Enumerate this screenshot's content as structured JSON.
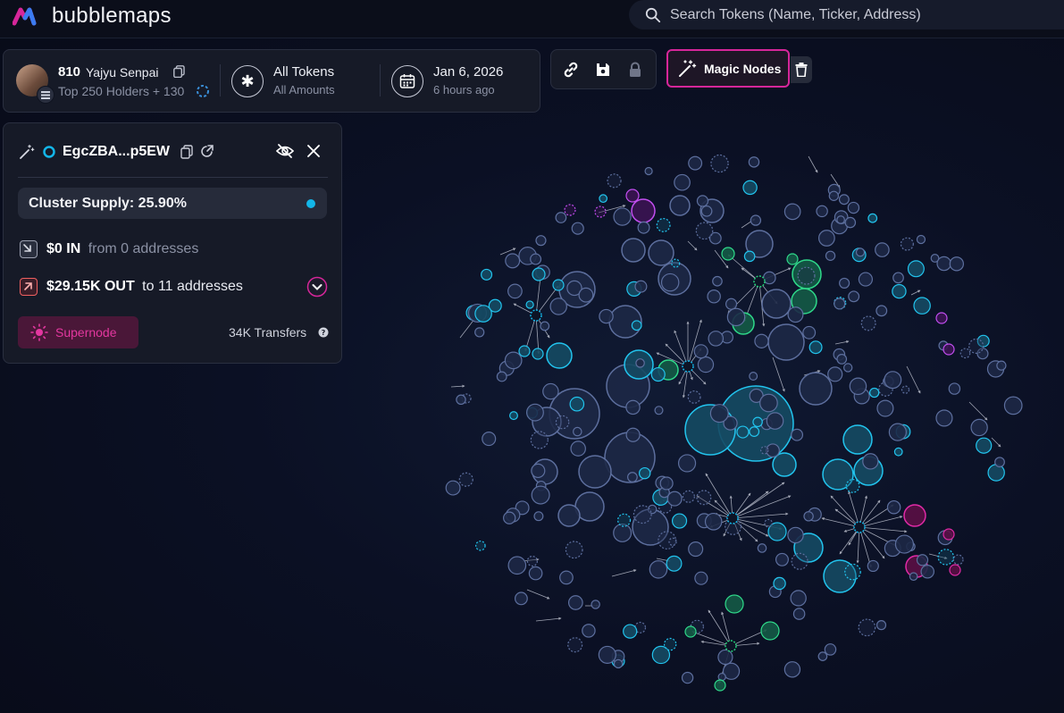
{
  "app": {
    "name": "bubblemaps"
  },
  "search": {
    "placeholder": "Search Tokens (Name, Ticker, Address)"
  },
  "token": {
    "count": "810",
    "name": "Yajyu Senpai",
    "holders_label": "Top 250 Holders + 130",
    "filter_main": "All Tokens",
    "filter_sub": "All Amounts",
    "date": "Jan 6, 2026",
    "date_sub": "6 hours ago"
  },
  "toolbar": {
    "link_icon": "link-icon",
    "save_icon": "save-icon",
    "lock_icon": "lock-icon",
    "magic_label": "Magic Nodes",
    "trash_icon": "trash-icon"
  },
  "node_panel": {
    "address": "EgcZBA...p5EW",
    "cluster_supply": "Cluster Supply: 25.90%",
    "in_amount": "$0 IN",
    "in_sub": "from 0 addresses",
    "out_amount": "$29.15K OUT",
    "out_sub": "to 11 addresses",
    "supernode_label": "Supernode",
    "transfers": "34K Transfers"
  },
  "colors": {
    "accent_pink": "#d6269a",
    "cyan": "#13b6e8",
    "green": "#25d07a",
    "purple": "#b23ad9",
    "node_blue": "#1e2a48"
  }
}
